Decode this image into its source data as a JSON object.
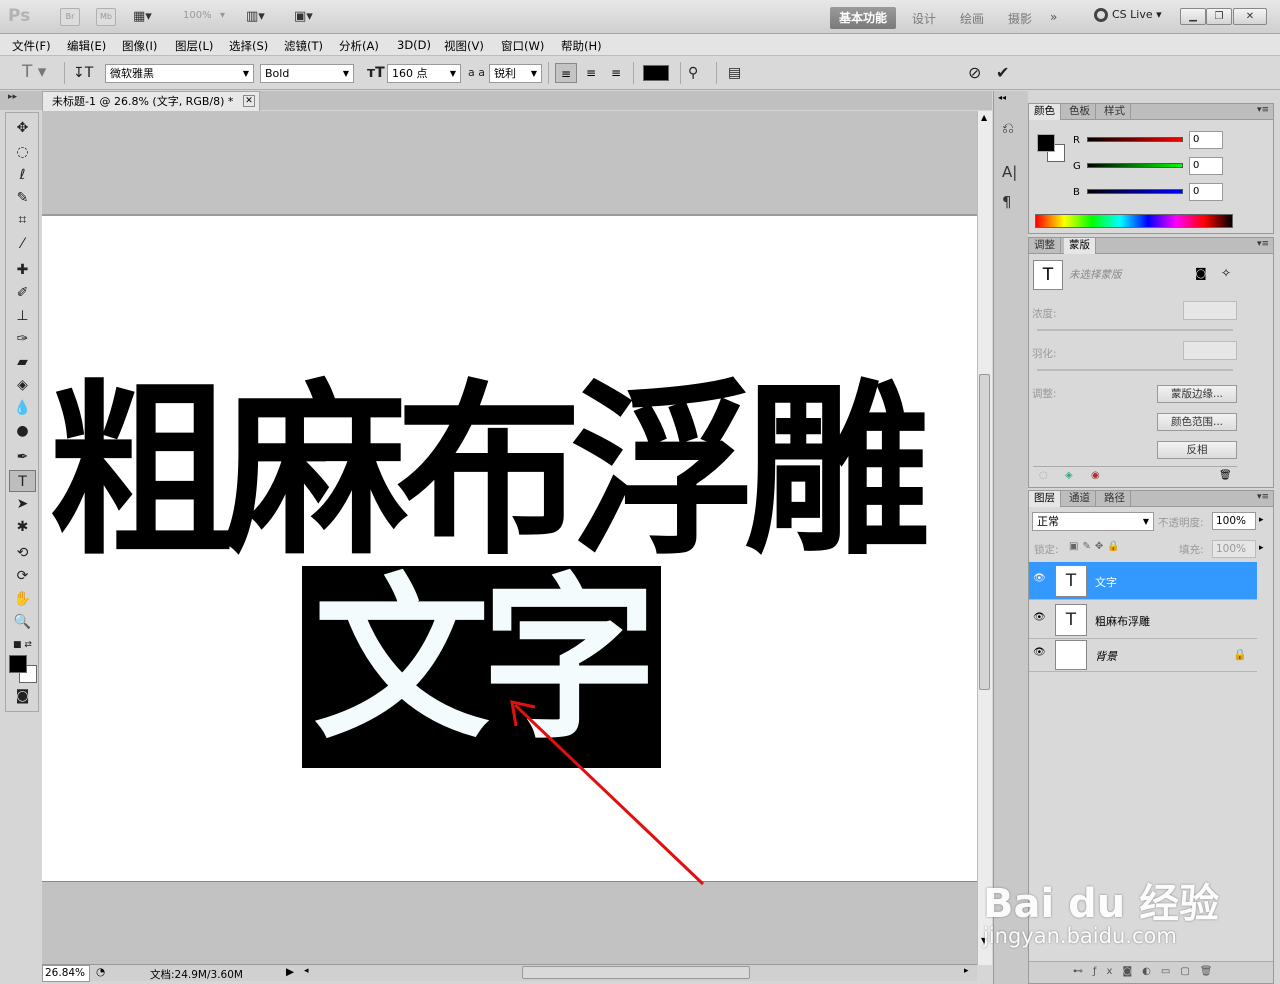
{
  "app": {
    "logo": "Ps",
    "bridge_label": "Br",
    "minibridge_label": "Mb",
    "zoom_display": "100%",
    "workspaces": [
      "基本功能",
      "设计",
      "绘画",
      "摄影"
    ],
    "more_workspaces": "»",
    "cs_live": "CS Live"
  },
  "menu": [
    "文件(F)",
    "编辑(E)",
    "图像(I)",
    "图层(L)",
    "选择(S)",
    "滤镜(T)",
    "分析(A)",
    "3D(D)",
    "视图(V)",
    "窗口(W)",
    "帮助(H)"
  ],
  "options": {
    "font_family": "微软雅黑",
    "font_style": "Bold",
    "font_size": "160 点",
    "aa_label": "a a",
    "antialias": "锐利"
  },
  "document": {
    "tab_title": "未标题-1 @ 26.8% (文字, RGB/8) *",
    "text_line1": "粗麻布浮雕",
    "text_line2": "文字"
  },
  "status": {
    "zoom": "26.84%",
    "doc_size": "文档:24.9M/3.60M"
  },
  "color_panel": {
    "tabs": [
      "颜色",
      "色板",
      "样式"
    ],
    "r": "0",
    "g": "0",
    "b": "0",
    "r_label": "R",
    "g_label": "G",
    "b_label": "B"
  },
  "masks_panel": {
    "tabs": [
      "调整",
      "蒙版"
    ],
    "no_mask": "未选择蒙版",
    "density_label": "浓度:",
    "feather_label": "羽化:",
    "refine_label": "调整:",
    "mask_edge": "蒙版边缘...",
    "color_range": "颜色范围...",
    "invert": "反相"
  },
  "layers_panel": {
    "tabs": [
      "图层",
      "通道",
      "路径"
    ],
    "blend_mode": "正常",
    "opacity_label": "不透明度:",
    "opacity": "100%",
    "lock_label": "锁定:",
    "fill_label": "填充:",
    "fill": "100%",
    "layers": [
      {
        "name": "文字",
        "type": "text",
        "selected": true
      },
      {
        "name": "粗麻布浮雕",
        "type": "text",
        "selected": false
      },
      {
        "name": "背景",
        "type": "background",
        "selected": false
      }
    ]
  },
  "watermark": {
    "brand": "Bai du 经验",
    "url": "jingyan.baidu.com"
  },
  "colors": {
    "selection_bg": "#000000",
    "selected_text": "#f4fbfc",
    "annotation_arrow": "#e01010",
    "layer_highlight": "#3399ff"
  }
}
